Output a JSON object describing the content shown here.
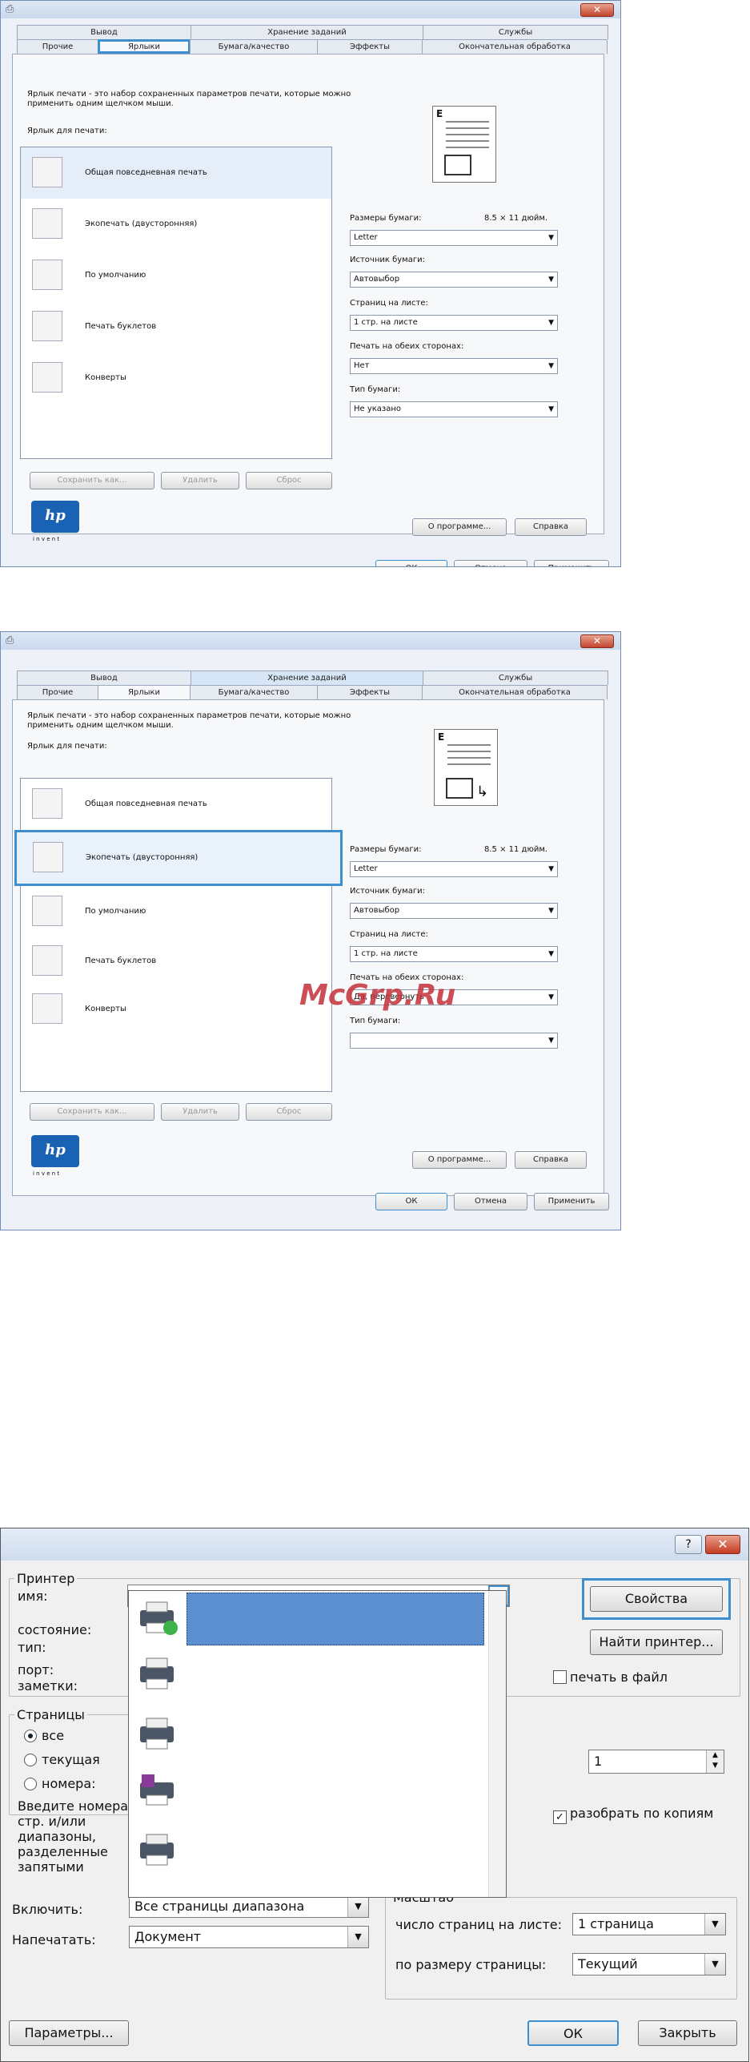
{
  "top": {
    "tabs_row1": [
      "Вывод",
      "Хранение заданий",
      "Службы"
    ],
    "tabs_row2": [
      "Прочие",
      "Ярлыки",
      "Бумага/качество",
      "Эффекты",
      "Окончательная обработка"
    ],
    "desc": "Ярлык печати - это набор сохраненных параметров печати, которые можно применить одним щелчком мыши.",
    "list_label": "Ярлык для печати:",
    "items": [
      "Общая повседневная печать",
      "Экопечать (двусторонняя)",
      "По умолчанию",
      "Печать буклетов",
      "Конверты"
    ],
    "paper_sizes_label": "Размеры бумаги:",
    "paper_size_value": "8.5 × 11 дюйм.",
    "paper_source_label": "Источник бумаги:",
    "pages_per_sheet_label": "Страниц на листе:",
    "duplex_label": "Печать на обеих сторонах:",
    "paper_type_label": "Тип бумаги:",
    "save_as": "Сохранить как...",
    "delete": "Удалить",
    "reset": "Сброс",
    "about": "О программе...",
    "help": "Справка",
    "ok": "ОК",
    "cancel": "Отмена",
    "apply": "Применить",
    "preview_letter": "E",
    "hp_logo": "hp",
    "hp_sub": "i n v e n t"
  },
  "win1": {
    "combos": [
      "Letter",
      "Автовыбор",
      "1 стр. на листе",
      "Нет",
      "Не указано"
    ]
  },
  "win2": {
    "combos": [
      "Letter",
      "Автовыбор",
      "1 стр. на листе",
      "Да, перевернуть",
      ""
    ]
  },
  "watermark": "McGrp.Ru",
  "print": {
    "printer_legend": "Принтер",
    "name_label": "имя:",
    "status_label": "состояние:",
    "type_label": "тип:",
    "port_label": "порт:",
    "notes_label": "заметки:",
    "properties": "Свойства",
    "find_printer": "Найти принтер...",
    "print_to_file": "печать в файл",
    "pages_legend": "Страницы",
    "all": "все",
    "current": "текущая",
    "numbers": "номера:",
    "pages_hint": "Введите номера стр. и/или диапазоны, разделенные запятыми",
    "copies_value": "1",
    "collate": "разобрать по копиям",
    "include_label": "Включить:",
    "include_value": "Все страницы диапазона",
    "print_what_label": "Напечатать:",
    "print_what_value": "Документ",
    "scale_legend": "Масштаб",
    "pps_label": "число страниц на листе:",
    "pps_value": "1 страница",
    "fit_label": "по размеру страницы:",
    "fit_value": "Текущий",
    "options": "Параметры...",
    "ok": "ОК",
    "close": "Закрыть",
    "help_q": "?",
    "close_x": "✕"
  },
  "colors": {
    "highlight": "#3d8fd0",
    "selection": "#5b8fd0"
  }
}
